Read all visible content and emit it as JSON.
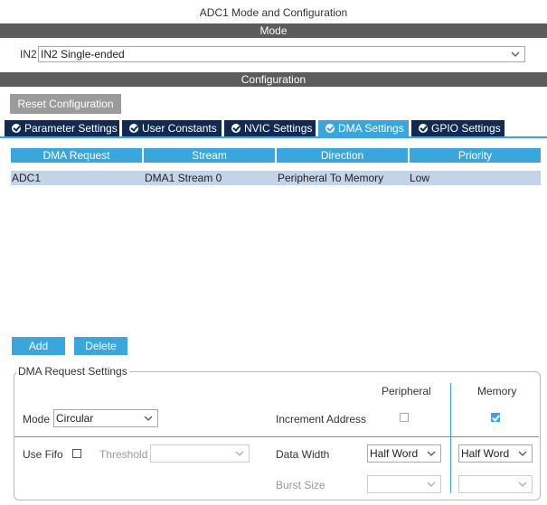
{
  "window": {
    "title": "ADC1 Mode and Configuration"
  },
  "mode_section": {
    "header": "Mode",
    "field_label": "IN2",
    "field_value": "IN2 Single-ended"
  },
  "config_section": {
    "header": "Configuration",
    "reset_label": "Reset Configuration"
  },
  "tabs": [
    {
      "label": "Parameter Settings",
      "active": false
    },
    {
      "label": "User Constants",
      "active": false
    },
    {
      "label": "NVIC Settings",
      "active": false
    },
    {
      "label": "DMA Settings",
      "active": true
    },
    {
      "label": "GPIO Settings",
      "active": false
    }
  ],
  "dma_table": {
    "columns": [
      "DMA Request",
      "Stream",
      "Direction",
      "Priority"
    ],
    "rows": [
      [
        "ADC1",
        "DMA1 Stream 0",
        "Peripheral To Memory",
        "Low"
      ]
    ]
  },
  "buttons": {
    "add": "Add",
    "delete": "Delete"
  },
  "dma_request_settings": {
    "legend": "DMA Request Settings",
    "peripheral_header": "Peripheral",
    "memory_header": "Memory",
    "mode_label": "Mode",
    "mode_value": "Circular",
    "increment_address_label": "Increment Address",
    "increment_peripheral": false,
    "increment_memory": true,
    "use_fifo_label": "Use Fifo",
    "use_fifo": false,
    "threshold_label": "Threshold",
    "threshold_value": "",
    "data_width_label": "Data Width",
    "data_width_peripheral": "Half Word",
    "data_width_memory": "Half Word",
    "burst_size_label": "Burst Size",
    "burst_size_peripheral": "",
    "burst_size_memory": ""
  },
  "colors": {
    "accent": "#3aa6dc",
    "tab_dark": "#102a53",
    "section_bar": "#5c5c5c",
    "row_selected": "#c3d3ea"
  }
}
